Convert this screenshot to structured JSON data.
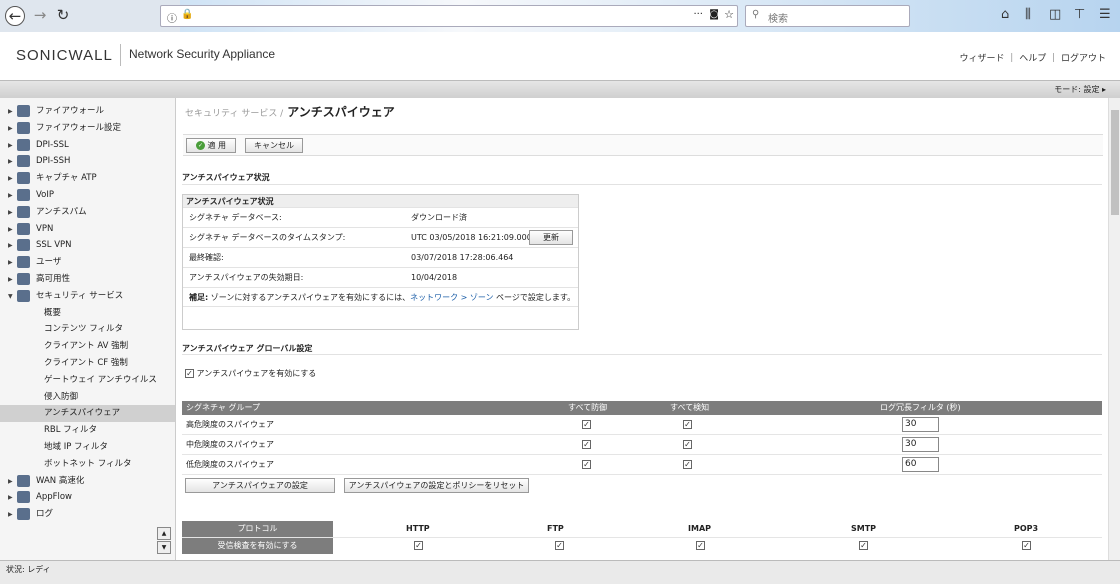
{
  "browser": {
    "search_placeholder": "検索",
    "more_glyph": "···"
  },
  "header": {
    "logo": "SONICWALL",
    "product": "Network Security Appliance",
    "nav": "ウィザード ｜ ヘルプ ｜ ログアウト"
  },
  "mode": "モード: 設定 ▸",
  "sidebar": {
    "items": [
      {
        "label": "ファイアウォール",
        "type": "top"
      },
      {
        "label": "ファイアウォール設定",
        "type": "top"
      },
      {
        "label": "DPI-SSL",
        "type": "top"
      },
      {
        "label": "DPI-SSH",
        "type": "top"
      },
      {
        "label": "キャプチャ ATP",
        "type": "top"
      },
      {
        "label": "VoIP",
        "type": "top"
      },
      {
        "label": "アンチスパム",
        "type": "top"
      },
      {
        "label": "VPN",
        "type": "top"
      },
      {
        "label": "SSL VPN",
        "type": "top"
      },
      {
        "label": "ユーザ",
        "type": "top"
      },
      {
        "label": "高可用性",
        "type": "top"
      },
      {
        "label": "セキュリティ サービス",
        "type": "open"
      },
      {
        "label": "概要",
        "type": "sub"
      },
      {
        "label": "コンテンツ フィルタ",
        "type": "sub"
      },
      {
        "label": "クライアント AV 強制",
        "type": "sub"
      },
      {
        "label": "クライアント CF 強制",
        "type": "sub"
      },
      {
        "label": "ゲートウェイ アンチウイルス",
        "type": "sub"
      },
      {
        "label": "侵入防御",
        "type": "sub"
      },
      {
        "label": "アンチスパイウェア",
        "type": "sub",
        "active": true
      },
      {
        "label": "RBL フィルタ",
        "type": "sub"
      },
      {
        "label": "地域 IP フィルタ",
        "type": "sub"
      },
      {
        "label": "ボットネット フィルタ",
        "type": "sub"
      },
      {
        "label": "WAN 高速化",
        "type": "top"
      },
      {
        "label": "AppFlow",
        "type": "top"
      },
      {
        "label": "ログ",
        "type": "top"
      }
    ]
  },
  "page": {
    "crumb": "セキュリティ サービス /",
    "title": "アンチスパイウェア",
    "apply": "適 用",
    "cancel": "キャンセル"
  },
  "status": {
    "section": "アンチスパイウェア状況",
    "box_title": "アンチスパイウェア状況",
    "rows": [
      {
        "k": "シグネチャ データベース:",
        "v": "ダウンロード済"
      },
      {
        "k": "シグネチャ データベースのタイムスタンプ:",
        "v": "UTC 03/05/2018 16:21:09.000"
      },
      {
        "k": "最終確認:",
        "v": "03/07/2018 17:28:06.464"
      },
      {
        "k": "アンチスパイウェアの失効期日:",
        "v": "10/04/2018"
      }
    ],
    "update": "更新",
    "note_bold": "補足:",
    "note_pre": " ゾーンに対するアンチスパイウェアを有効にするには、",
    "note_link": "ネットワーク > ゾーン",
    "note_post": " ページで設定します。"
  },
  "global": {
    "section": "アンチスパイウェア グローバル設定",
    "enable": "アンチスパイウェアを有効にする",
    "headers": {
      "group": "シグネチャ グループ",
      "prevent": "すべて防御",
      "detect": "すべて検知",
      "log": "ログ冗長フィルタ (秒)"
    },
    "rows": [
      {
        "name": "高危険度のスパイウェア",
        "prevent": true,
        "detect": true,
        "log": "30"
      },
      {
        "name": "中危険度のスパイウェア",
        "prevent": true,
        "detect": true,
        "log": "30"
      },
      {
        "name": "低危険度のスパイウェア",
        "prevent": true,
        "detect": true,
        "log": "60"
      }
    ],
    "settings_btn": "アンチスパイウェアの設定",
    "reset_btn": "アンチスパイウェアの設定とポリシーをリセット"
  },
  "protocols": {
    "label": "プロトコル",
    "row_label": "受信検査を有効にする",
    "cols": [
      "HTTP",
      "FTP",
      "IMAP",
      "SMTP",
      "POP3"
    ]
  },
  "statusbar": "状況: レディ"
}
